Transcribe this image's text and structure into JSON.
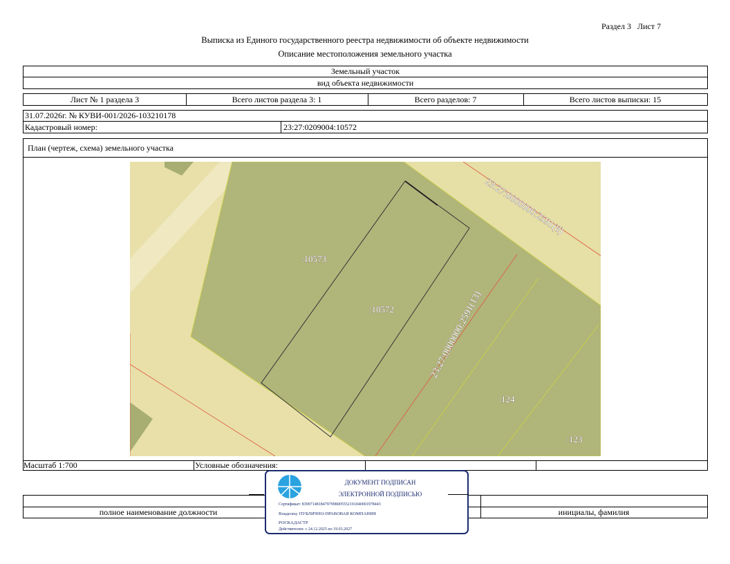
{
  "header": {
    "section_sheet": "Раздел 3   Лист 7",
    "title": "Выписка из Единого государственного реестра недвижимости об объекте недвижимости",
    "subtitle": "Описание местоположения земельного участка"
  },
  "object": {
    "type": "Земельный участок",
    "type_caption": "вид объекта недвижимости"
  },
  "sheets": {
    "sheet_no": "Лист № 1 раздела 3",
    "total_section_sheets": "Всего листов раздела 3: 1",
    "total_sections": "Всего разделов: 7",
    "total_extract_sheets": "Всего листов выписки: 15"
  },
  "record": {
    "date_number": "31.07.2026г. № КУВИ-001/2026-103210178",
    "cadastral_label": "Кадастровый номер:",
    "cadastral_value": "23:27:0209004:10572"
  },
  "plan": {
    "title": "План (чертеж, схема) земельного участка",
    "labels": {
      "road_top": "23:27:0000000:2591(8)",
      "road_diag": "23:27:0000000:2591(13)",
      "parcel_a": ":10573",
      "parcel_b": ":10572",
      "parcel_c": ":124",
      "parcel_d": ":123"
    }
  },
  "footer": {
    "scale": "Масштаб 1:700",
    "legend_label": "Условные обозначения:",
    "position_caption": "полное наименование должности",
    "name_caption": "инициалы, фамилия"
  },
  "stamp": {
    "line1": "ДОКУМЕНТ ПОДПИСАН",
    "line2": "ЭЛЕКТРОННОЙ ПОДПИСЬЮ",
    "certificate": "Сертификат: 83997148184797998005552191040001978443",
    "owner_1": "Владелец: ПУБЛИЧНО-ПРАВОВАЯ КОМПАНИЯ",
    "owner_2": "РОСКАДАСТР",
    "validity": "Действителен: с 24.12.2025 по 19.03.2027",
    "border_color": "#1a2a6e",
    "logo_color": "#2aa3e0"
  },
  "colors": {
    "map_background": "#e8e0a8",
    "parcel_fill": "#b0b57a",
    "boundary_red": "#e0553e"
  }
}
